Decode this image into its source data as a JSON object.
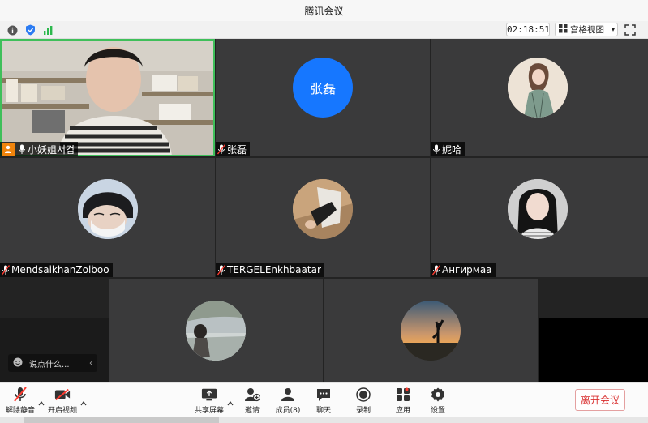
{
  "window": {
    "title": "腾讯会议"
  },
  "infobar": {
    "timer": "02:18:51",
    "view_mode": "宫格视图"
  },
  "participants": [
    {
      "name": "小妖姐서검",
      "video": true
    },
    {
      "name": "张磊",
      "avatar_text": "张磊",
      "avatar_color": "#1677ff"
    },
    {
      "name": "妮哈"
    },
    {
      "name": "MendsaikhanZolboo"
    },
    {
      "name": "TERGELEnkhbaatar"
    },
    {
      "name": "Ангирмаа"
    },
    {
      "name": ""
    },
    {
      "name": ""
    }
  ],
  "chat": {
    "placeholder": "说点什么..."
  },
  "toolbar": {
    "unmute": "解除静音",
    "start_video": "开启视频",
    "share_screen": "共享屏幕",
    "invite": "邀请",
    "members": "成员(8)",
    "chat": "聊天",
    "record": "录制",
    "apps": "应用",
    "settings": "设置",
    "leave": "离开会议"
  },
  "colors": {
    "accent_green": "#3fbf5a",
    "leave_red": "#d93030",
    "avatar_blue": "#1677ff"
  }
}
